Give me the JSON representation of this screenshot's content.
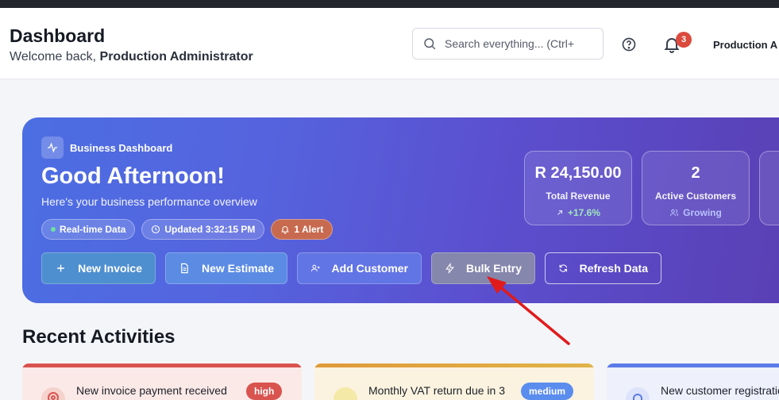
{
  "header": {
    "title": "Dashboard",
    "welcome_prefix": "Welcome back, ",
    "welcome_user": "Production Administrator",
    "search_placeholder": "Search everything... (Ctrl+",
    "notification_count": "3",
    "user_name": "Production A"
  },
  "hero": {
    "ribbon_label": "Business Dashboard",
    "greeting": "Good Afternoon!",
    "overview": "Here's your business performance overview",
    "chips": {
      "realtime": "Real-time Data",
      "updated": "Updated 3:32:15 PM",
      "alert": "1 Alert"
    },
    "actions": {
      "new_invoice": "New Invoice",
      "new_estimate": "New Estimate",
      "add_customer": "Add Customer",
      "bulk_entry": "Bulk Entry",
      "refresh_data": "Refresh Data"
    },
    "stats": [
      {
        "value": "R 24,150.00",
        "label": "Total Revenue",
        "sub": "+17.6%"
      },
      {
        "value": "2",
        "label": "Active Customers",
        "sub": "Growing"
      }
    ]
  },
  "activities": {
    "title": "Recent Activities",
    "items": [
      {
        "title": "New invoice payment received",
        "badge": "high",
        "color": "#d9534f"
      },
      {
        "title": "Monthly VAT return due in 3",
        "badge": "medium",
        "color": "#5b8def"
      },
      {
        "title": "New customer registratio",
        "badge": "",
        "color": "#5b7be8"
      }
    ]
  },
  "colors": {
    "accent": "#5b4fcf",
    "badge_red": "#dc4a3d",
    "annotation_arrow": "#e01b1b"
  }
}
